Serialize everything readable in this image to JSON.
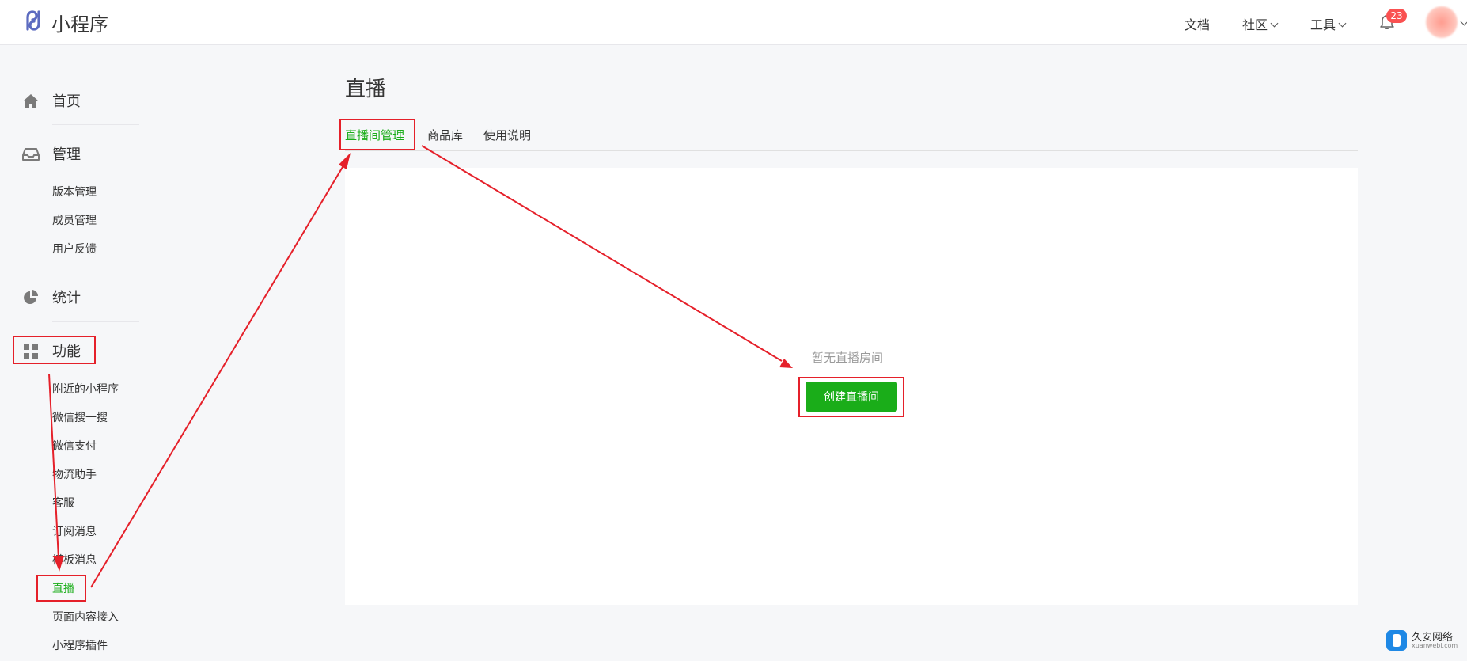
{
  "app": {
    "name": "小程序"
  },
  "header": {
    "nav": [
      {
        "label": "文档",
        "has_dropdown": false
      },
      {
        "label": "社区",
        "has_dropdown": true
      },
      {
        "label": "工具",
        "has_dropdown": true
      }
    ],
    "notification_count": "23",
    "icons": {
      "logo": "miniprogram-logo-icon",
      "bell": "bell-icon"
    }
  },
  "sidebar": {
    "home": {
      "label": "首页",
      "icon": "home-icon"
    },
    "manage": {
      "label": "管理",
      "icon": "inbox-icon",
      "items": [
        "版本管理",
        "成员管理",
        "用户反馈"
      ]
    },
    "stats": {
      "label": "统计",
      "icon": "pie-chart-icon"
    },
    "features": {
      "label": "功能",
      "icon": "grid-icon",
      "items": [
        "附近的小程序",
        "微信搜一搜",
        "微信支付",
        "物流助手",
        "客服",
        "订阅消息",
        "模板消息",
        "直播",
        "页面内容接入",
        "小程序插件"
      ],
      "active": "直播"
    }
  },
  "main": {
    "title": "直播",
    "tabs": [
      {
        "label": "直播间管理",
        "active": true
      },
      {
        "label": "商品库",
        "active": false
      },
      {
        "label": "使用说明",
        "active": false
      }
    ],
    "empty_state": "暂无直播房间",
    "create_button": "创建直播间"
  },
  "watermark": {
    "title": "久安网络",
    "subtitle": "xuanwebi.com"
  },
  "colors": {
    "accent": "#1aad19",
    "annotation": "#e5202a",
    "badge": "#fa5151",
    "logo": "#5c6bc0"
  }
}
